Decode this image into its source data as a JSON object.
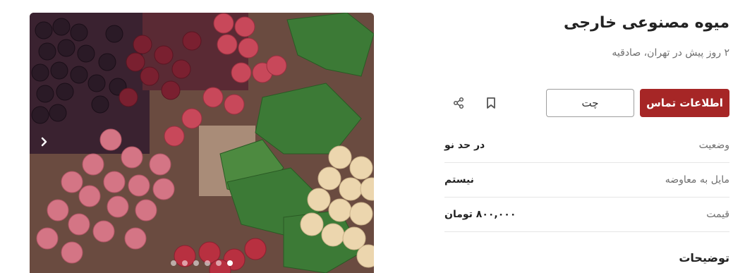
{
  "listing": {
    "title": "میوه مصنوعی خارجی",
    "subtitle": "۲ روز پیش در تهران، صادقیه"
  },
  "actions": {
    "contact_label": "اطلاعات تماس",
    "chat_label": "چت",
    "bookmark_icon": "bookmark-icon",
    "share_icon": "share-icon"
  },
  "details": [
    {
      "label": "وضعیت",
      "value": "در حد نو"
    },
    {
      "label": "مایل به معاوضه",
      "value": "نیستم"
    },
    {
      "label": "قیمت",
      "value": "۸۰۰,۰۰۰ تومان"
    }
  ],
  "description": {
    "title": "توضیحات"
  },
  "gallery": {
    "image_count": 6,
    "active_index": 5
  },
  "colors": {
    "accent": "#a62626",
    "muted_text": "#6f6f6f"
  }
}
